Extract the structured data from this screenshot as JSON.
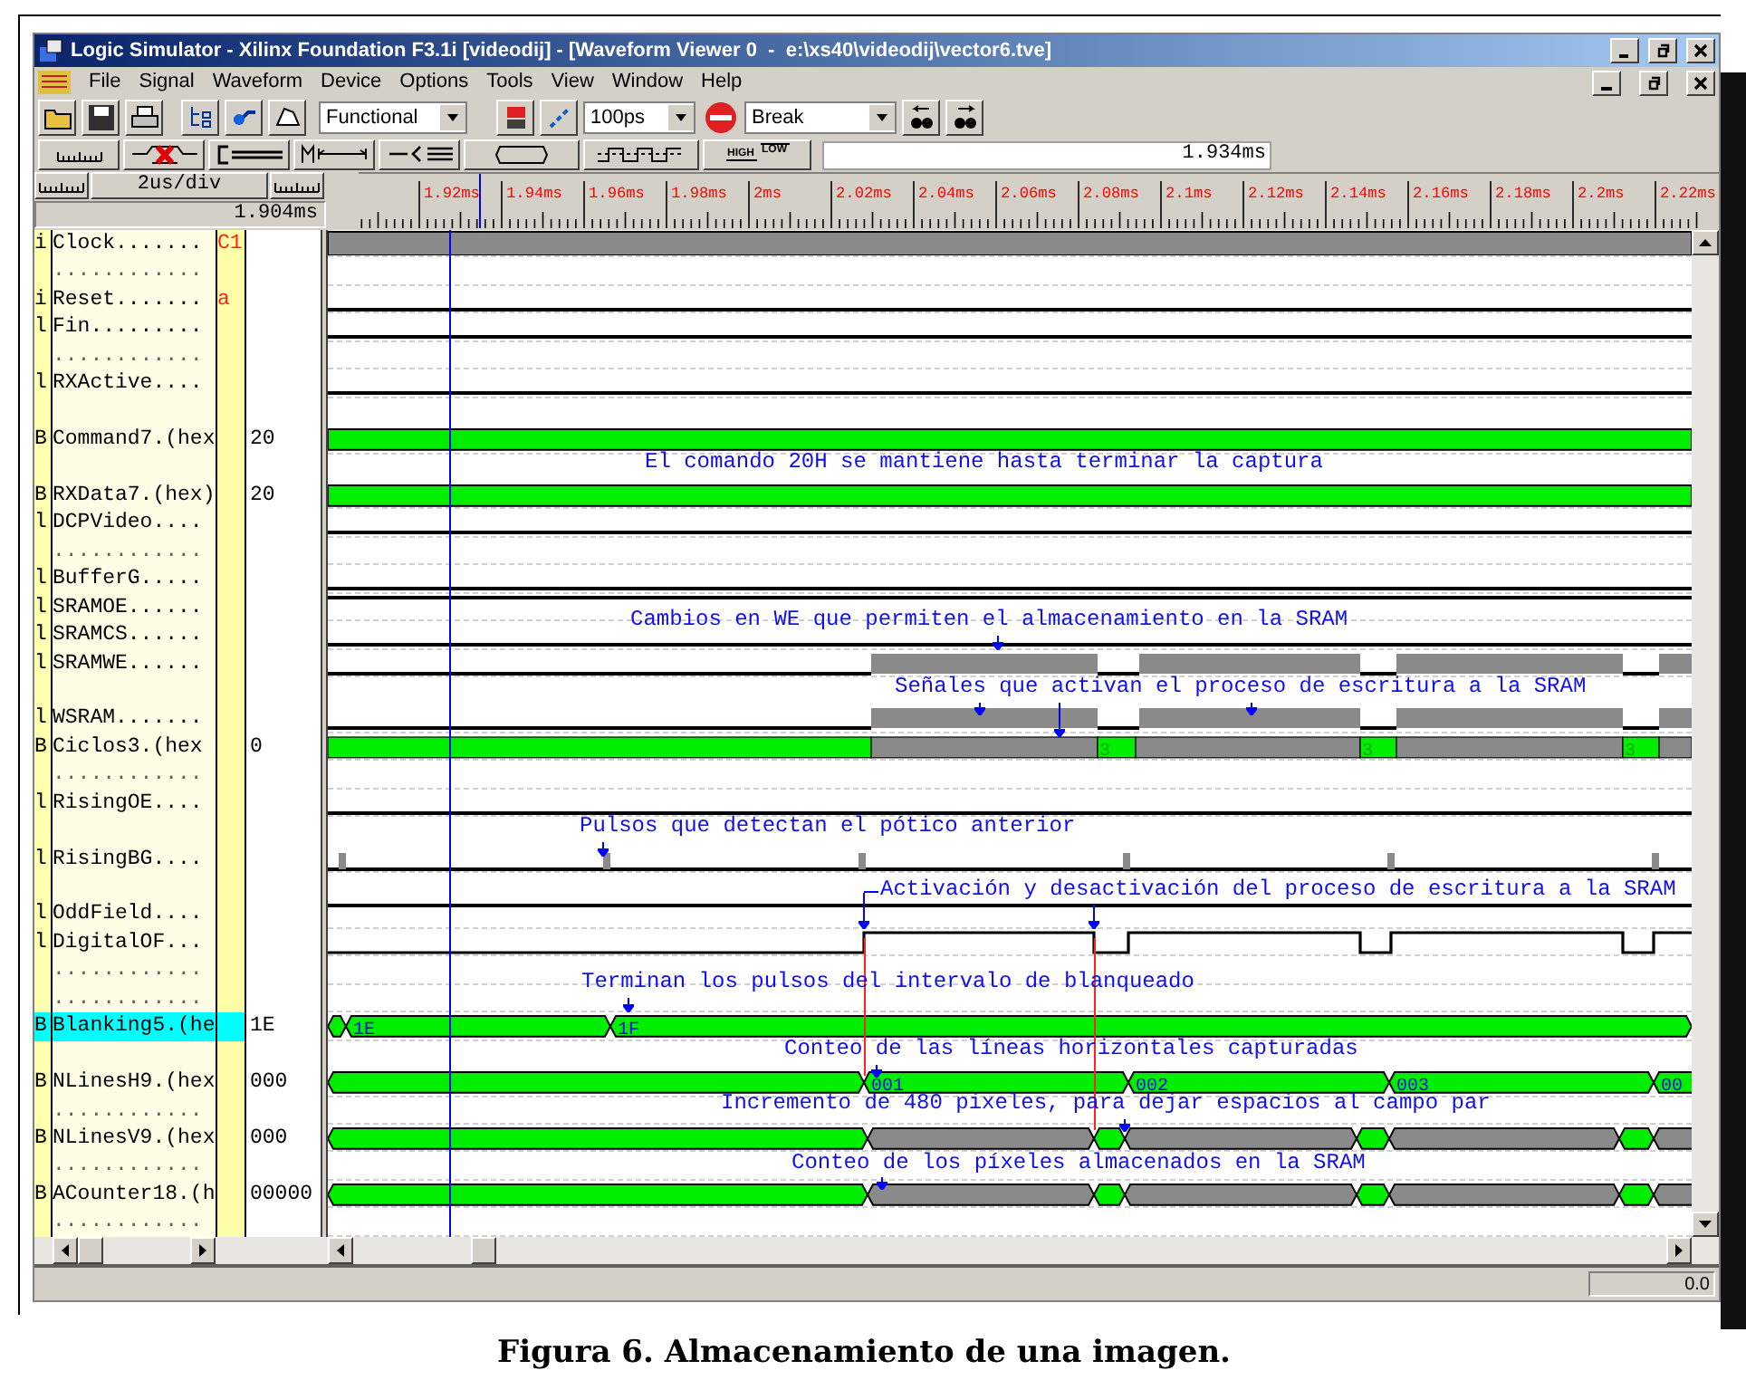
{
  "window": {
    "title": "Logic Simulator - Xilinx Foundation F3.1i [videodij] - [Waveform Viewer 0  -  e:\\xs40\\videodij\\vector6.tve]"
  },
  "menu": [
    "File",
    "Signal",
    "Waveform",
    "Device",
    "Options",
    "Tools",
    "View",
    "Window",
    "Help"
  ],
  "toolbar": {
    "mode": "Functional",
    "step": "100ps",
    "break": "Break",
    "high_label": "HIGH",
    "low_label": "LOW",
    "cursor_time": "1.934ms"
  },
  "ruler": {
    "scale": "2us/div",
    "start_time": "1.904ms",
    "labels": [
      "1.92ms",
      "1.94ms",
      "1.96ms",
      "1.98ms",
      "2ms",
      "2.02ms",
      "2.04ms",
      "2.06ms",
      "2.08ms",
      "2.1ms",
      "2.12ms",
      "2.14ms",
      "2.16ms",
      "2.18ms",
      "2.2ms",
      "2.22ms"
    ]
  },
  "rows": [
    {
      "kind": "clock",
      "type": "i",
      "name": "Clock.......",
      "marker": "C1",
      "selected": false
    },
    {
      "kind": "dots",
      "name": "............"
    },
    {
      "kind": "low",
      "type": "i",
      "name": "Reset.......",
      "marker": "a",
      "selected": false
    },
    {
      "kind": "low",
      "type": "l",
      "name": "Fin.........",
      "selected": false
    },
    {
      "kind": "dots",
      "name": "............"
    },
    {
      "kind": "low",
      "type": "l",
      "name": "RXActive....",
      "selected": false
    },
    {
      "kind": "blank"
    },
    {
      "kind": "bus",
      "type": "B",
      "name": "Command7.(hex",
      "value": "20",
      "selected": false
    },
    {
      "kind": "blank"
    },
    {
      "kind": "bus",
      "type": "B",
      "name": "RXData7.(hex)",
      "value": "20",
      "selected": false
    },
    {
      "kind": "low",
      "type": "l",
      "name": "DCPVideo....",
      "selected": false
    },
    {
      "kind": "dots",
      "name": "............"
    },
    {
      "kind": "low",
      "type": "l",
      "name": "BufferG.....",
      "selected": false
    },
    {
      "kind": "high",
      "type": "l",
      "name": "SRAMOE......",
      "selected": false
    },
    {
      "kind": "low",
      "type": "l",
      "name": "SRAMCS......",
      "selected": false
    },
    {
      "kind": "strobe",
      "type": "l",
      "name": "SRAMWE......",
      "selected": false
    },
    {
      "kind": "blank"
    },
    {
      "kind": "strobe",
      "type": "l",
      "name": "WSRAM.......",
      "selected": false
    },
    {
      "kind": "cycles",
      "type": "B",
      "name": "Ciclos3.(hex",
      "value": "0",
      "labels": [
        "3",
        "3",
        "3"
      ],
      "selected": false
    },
    {
      "kind": "dots",
      "name": "............"
    },
    {
      "kind": "low",
      "type": "l",
      "name": "RisingOE....",
      "selected": false
    },
    {
      "kind": "blank"
    },
    {
      "kind": "pulses",
      "type": "l",
      "name": "RisingBG....",
      "selected": false
    },
    {
      "kind": "blank"
    },
    {
      "kind": "high",
      "type": "l",
      "name": "OddField....",
      "selected": false
    },
    {
      "kind": "digital",
      "type": "l",
      "name": "DigitalOF...",
      "selected": false
    },
    {
      "kind": "dots",
      "name": "............"
    },
    {
      "kind": "dots",
      "name": "............"
    },
    {
      "kind": "blanking",
      "type": "B",
      "name": "Blanking5.(he",
      "value": "1E",
      "labels": [
        "1E",
        "1F"
      ],
      "selected": true
    },
    {
      "kind": "blank"
    },
    {
      "kind": "lines",
      "type": "B",
      "name": "NLinesH9.(hex",
      "value": "000",
      "labels": [
        "001",
        "002",
        "003",
        "00"
      ],
      "selected": false
    },
    {
      "kind": "dots",
      "name": "............"
    },
    {
      "kind": "counter",
      "type": "B",
      "name": "NLinesV9.(hex",
      "value": "000",
      "selected": false
    },
    {
      "kind": "dots",
      "name": "............"
    },
    {
      "kind": "counter",
      "type": "B",
      "name": "ACounter18.(h",
      "value": "00000",
      "selected": false
    },
    {
      "kind": "dots",
      "name": "............"
    }
  ],
  "annotations": [
    "El comando 20H se mantiene hasta terminar la captura",
    "Cambios en WE que permiten el almacenamiento en la SRAM",
    "Señales que activan el proceso de escritura a la SRAM",
    "Pulsos que detectan el pótico anterior",
    "Activación y desactivación del proceso de escritura a la SRAM",
    "Terminan los pulsos del intervalo de blanqueado",
    "Conteo de las líneas horizontales capturadas",
    "Incremento de 480 pixeles, para dejar espacios al campo par",
    "Conteo de los píxeles almacenados en la SRAM"
  ],
  "status_bar": {
    "value": "0.0"
  },
  "caption": "Figura 6. Almacenamiento de una imagen."
}
